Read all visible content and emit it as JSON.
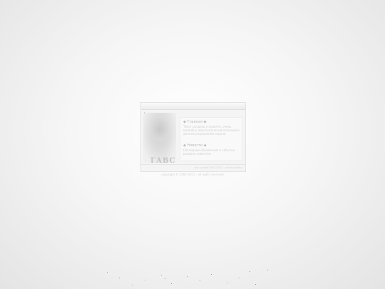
{
  "card": {
    "logo_text": "ГАВС",
    "about": {
      "heading": "◆ Главная ◆",
      "text": "Текст раздела о проекте, очень мелкий и практически нечитаемый в данном разрешении экрана."
    },
    "news": {
      "heading": "◆ Новости ◆",
      "text": "Последние обновления и события раздела новостей."
    },
    "footer": {
      "links": "· · · · · ·",
      "right": "last update 2007-2011 · privacy policy"
    }
  },
  "copyright": "copyright © 2007-2011 · all rights reserved"
}
